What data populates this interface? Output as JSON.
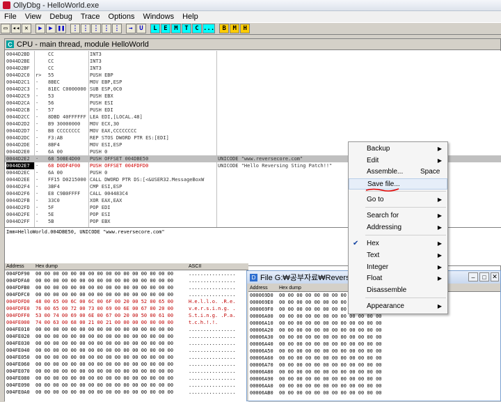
{
  "window": {
    "title": "OllyDbg - HelloWorld.exe"
  },
  "menubar": [
    "File",
    "View",
    "Debug",
    "Trace",
    "Options",
    "Windows",
    "Help"
  ],
  "toolbar": {
    "groupA": [
      "L",
      "E",
      "M",
      "T",
      "C",
      "..."
    ],
    "groupB": [
      "B",
      "M",
      "H"
    ]
  },
  "cpu": {
    "title": "CPU - main thread, module HelloWorld"
  },
  "disasm": [
    {
      "addr": "0044D2BD",
      "mark": "",
      "hex": "CC",
      "ins": "INT3",
      "com": ""
    },
    {
      "addr": "0044D2BE",
      "mark": "",
      "hex": "CC",
      "ins": "INT3",
      "com": ""
    },
    {
      "addr": "0044D2BF",
      "mark": "",
      "hex": "CC",
      "ins": "INT3",
      "com": ""
    },
    {
      "addr": "0044D2C0",
      "mark": "r>",
      "hex": "55",
      "ins": "PUSH EBP",
      "com": ""
    },
    {
      "addr": "0044D2C1",
      "mark": "·",
      "hex": "8BEC",
      "ins": "MOV EBP,ESP",
      "com": ""
    },
    {
      "addr": "0044D2C3",
      "mark": "·",
      "hex": "81EC C0000000",
      "ins": "SUB ESP,0C0",
      "com": ""
    },
    {
      "addr": "0044D2C9",
      "mark": "·",
      "hex": "53",
      "ins": "PUSH EBX",
      "com": ""
    },
    {
      "addr": "0044D2CA",
      "mark": "·",
      "hex": "56",
      "ins": "PUSH ESI",
      "com": ""
    },
    {
      "addr": "0044D2CB",
      "mark": "·",
      "hex": "57",
      "ins": "PUSH EDI",
      "com": ""
    },
    {
      "addr": "0044D2CC",
      "mark": "·",
      "hex": "8DBD 40FFFFFF",
      "ins": "LEA EDI,[LOCAL.48]",
      "com": ""
    },
    {
      "addr": "0044D2D2",
      "mark": "·",
      "hex": "B9 30000000",
      "ins": "MOV ECX,30",
      "com": ""
    },
    {
      "addr": "0044D2D7",
      "mark": "·",
      "hex": "B8 CCCCCCCC",
      "ins": "MOV EAX,CCCCCCCC",
      "com": ""
    },
    {
      "addr": "0044D2DC",
      "mark": "·",
      "hex": "F3:AB",
      "ins": "REP STOS DWORD PTR ES:[EDI]",
      "com": ""
    },
    {
      "addr": "0044D2DE",
      "mark": "·",
      "hex": "8BF4",
      "ins": "MOV ESI,ESP",
      "com": ""
    },
    {
      "addr": "0044D2E0",
      "mark": "·",
      "hex": "6A 00",
      "ins": "PUSH 0",
      "com": ""
    },
    {
      "addr": "0044D2E2",
      "mark": "·",
      "hex": "68 50BE4D00",
      "ins": "PUSH OFFSET 004DBE50",
      "com": "UNICODE \"www.reversecore.com\""
    },
    {
      "addr": "0044D2E7",
      "mark": "·",
      "hex": "68 D0DF4F00",
      "ins": "PUSH OFFSET 004FDFD0",
      "com": "UNICODE \"Hello Reversing Sting Patch!!\""
    },
    {
      "addr": "0044D2EC",
      "mark": "·",
      "hex": "6A 00",
      "ins": "PUSH 0",
      "com": ""
    },
    {
      "addr": "0044D2EE",
      "mark": "·",
      "hex": "FF15 D0215000",
      "ins": "CALL DWORD PTR DS:[<&USER32.MessageBoxW",
      "com": ""
    },
    {
      "addr": "0044D2F4",
      "mark": "·",
      "hex": "3BF4",
      "ins": "CMP ESI,ESP",
      "com": ""
    },
    {
      "addr": "0044D2F6",
      "mark": "·",
      "hex": "E8 C9B0FFFF",
      "ins": "CALL 004483C4",
      "com": ""
    },
    {
      "addr": "0044D2FB",
      "mark": "·",
      "hex": "33C0",
      "ins": "XOR EAX,EAX",
      "com": ""
    },
    {
      "addr": "0044D2FD",
      "mark": "·",
      "hex": "5F",
      "ins": "POP EDI",
      "com": ""
    },
    {
      "addr": "0044D2FE",
      "mark": "·",
      "hex": "5E",
      "ins": "POP ESI",
      "com": ""
    },
    {
      "addr": "0044D2FF",
      "mark": "·",
      "hex": "5B",
      "ins": "POP EBX",
      "com": ""
    }
  ],
  "info": "Imm=HelloWorld.004DBE50, UNICODE \"www.reversecore.com\"",
  "dump": {
    "headers": {
      "addr": "Address",
      "hex": "Hex dump",
      "ascii": "ASCII"
    },
    "rows": [
      {
        "addr": "004FDF90",
        "hex": "00 00 00 00 00 00 00 00 00 00 00 00 00 00 00 00",
        "asc": "................",
        "hl": false
      },
      {
        "addr": "004FDFA0",
        "hex": "00 00 00 00 00 00 00 00 00 00 00 00 00 00 00 00",
        "asc": "................",
        "hl": false
      },
      {
        "addr": "004FDFB0",
        "hex": "00 00 00 00 00 00 00 00 00 00 00 00 00 00 00 00",
        "asc": "................",
        "hl": false
      },
      {
        "addr": "004FDFC0",
        "hex": "00 00 00 00 00 00 00 00 00 00 00 00 00 00 00 00",
        "asc": "................",
        "hl": false
      },
      {
        "addr": "004FDFD0",
        "hex": "48 00 65 00 6C 00 6C 00 6F 00 20 00 52 00 65 00",
        "asc": "H.e.l.l.o. .R.e.",
        "hl": true
      },
      {
        "addr": "004FDFE0",
        "hex": "76 00 65 00 72 00 73 00 69 00 6E 00 67 00 20 00",
        "asc": "v.e.r.s.i.n.g. .",
        "hl": true
      },
      {
        "addr": "004FDFF0",
        "hex": "53 00 74 00 69 00 6E 00 67 00 20 00 50 00 61 00",
        "asc": "S.t.i.n.g. .P.a.",
        "hl": true
      },
      {
        "addr": "004FE000",
        "hex": "74 00 63 00 68 00 21 00 21 00 00 00 00 00 00 00",
        "asc": "t.c.h.!.!.",
        "hl": true
      },
      {
        "addr": "004FE010",
        "hex": "00 00 00 00 00 00 00 00 00 00 00 00 00 00 00 00",
        "asc": "................",
        "hl": false
      },
      {
        "addr": "004FE020",
        "hex": "00 00 00 00 00 00 00 00 00 00 00 00 00 00 00 00",
        "asc": "................",
        "hl": false
      },
      {
        "addr": "004FE030",
        "hex": "00 00 00 00 00 00 00 00 00 00 00 00 00 00 00 00",
        "asc": "................",
        "hl": false
      },
      {
        "addr": "004FE040",
        "hex": "00 00 00 00 00 00 00 00 00 00 00 00 00 00 00 00",
        "asc": "................",
        "hl": false
      },
      {
        "addr": "004FE050",
        "hex": "00 00 00 00 00 00 00 00 00 00 00 00 00 00 00 00",
        "asc": "................",
        "hl": false
      },
      {
        "addr": "004FE060",
        "hex": "00 00 00 00 00 00 00 00 00 00 00 00 00 00 00 00",
        "asc": "................",
        "hl": false
      },
      {
        "addr": "004FE070",
        "hex": "00 00 00 00 00 00 00 00 00 00 00 00 00 00 00 00",
        "asc": "................",
        "hl": false
      },
      {
        "addr": "004FE080",
        "hex": "00 00 00 00 00 00 00 00 00 00 00 00 00 00 00 00",
        "asc": "................",
        "hl": false
      },
      {
        "addr": "004FE090",
        "hex": "00 00 00 00 00 00 00 00 00 00 00 00 00 00 00 00",
        "asc": "................",
        "hl": false
      },
      {
        "addr": "004FE0A0",
        "hex": "00 00 00 00 00 00 00 00 00 00 00 00 00 00 00 00",
        "asc": "................",
        "hl": false
      }
    ]
  },
  "filewin": {
    "title": "File G:₩공부자료₩Reversing₩",
    "headers": {
      "addr": "Address",
      "hex": "Hex dump"
    },
    "rows": [
      {
        "addr": "000069D0",
        "hex": "00 00 00 00 00 00 00 00 00 00 00 00"
      },
      {
        "addr": "000069E0",
        "hex": "00 00 00 00 00 00 00 00 00 00 00 00"
      },
      {
        "addr": "000069F0",
        "hex": "00 00 00 00 00 00 00 00 00 00 00 00"
      },
      {
        "addr": "00006A00",
        "hex": "00 00 00 00 00 00 00 00 00 00 00 00"
      },
      {
        "addr": "00006A10",
        "hex": "00 00 00 00 00 00 00 00 00 00 00 00"
      },
      {
        "addr": "00006A20",
        "hex": "00 00 00 00 00 00 00 00 00 00 00 00"
      },
      {
        "addr": "00006A30",
        "hex": "00 00 00 00 00 00 00 00 00 00 00 00"
      },
      {
        "addr": "00006A40",
        "hex": "00 00 00 00 00 00 00 00 00 00 00 00"
      },
      {
        "addr": "00006A50",
        "hex": "00 00 00 00 00 00 00 00 00 00 00 00"
      },
      {
        "addr": "00006A60",
        "hex": "00 00 00 00 00 00 00 00 00 00 00 00"
      },
      {
        "addr": "00006A70",
        "hex": "00 00 00 00 00 00 00 00 00 00 00 00"
      },
      {
        "addr": "00006A80",
        "hex": "00 00 00 00 00 00 00 00 00 00 00 00"
      },
      {
        "addr": "00006A90",
        "hex": "00 00 00 00 00 00 00 00 00 00 00 00"
      },
      {
        "addr": "00006AA0",
        "hex": "00 00 00 00 00 00 00 00 00 00 00 00"
      },
      {
        "addr": "00006AB0",
        "hex": "00 00 00 00 00 00 00 00 00 00 00 00"
      }
    ]
  },
  "context_menu": {
    "backup": "Backup",
    "edit": "Edit",
    "assemble": "Assemble...",
    "assemble_shortcut": "Space",
    "save_file": "Save file...",
    "go_to": "Go to",
    "search_for": "Search for",
    "addressing": "Addressing",
    "hex": "Hex",
    "text": "Text",
    "integer": "Integer",
    "float": "Float",
    "disassemble": "Disassemble",
    "appearance": "Appearance"
  }
}
